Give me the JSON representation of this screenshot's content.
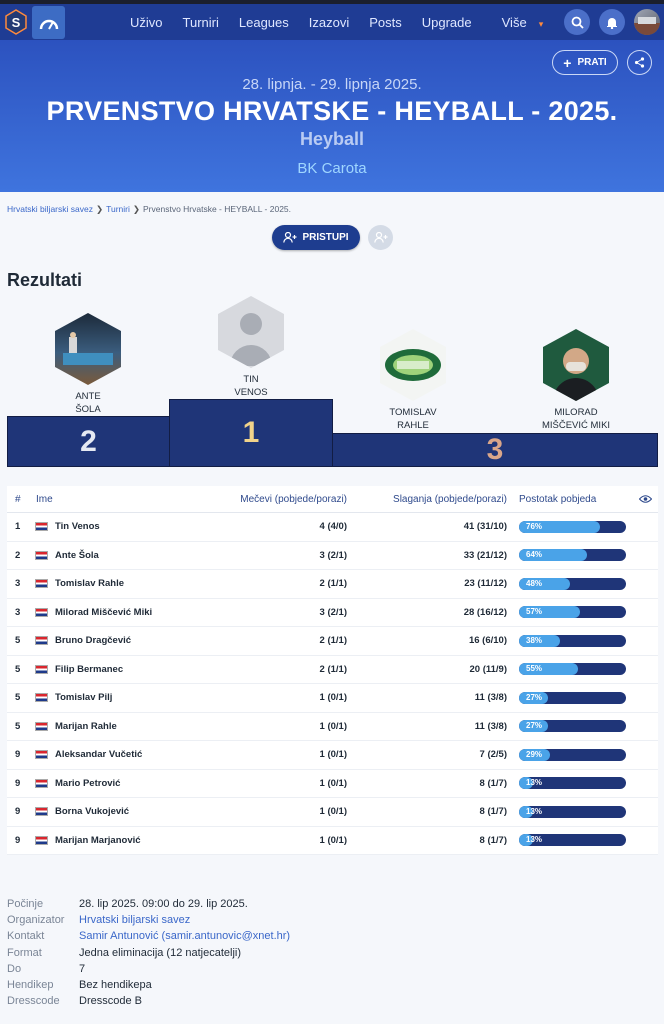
{
  "nav": {
    "links": [
      "Uživo",
      "Turniri",
      "Leagues",
      "Izazovi",
      "Posts",
      "Upgrade",
      "Više"
    ]
  },
  "hero": {
    "dates": "28. lipnja. - 29. lipnja 2025.",
    "title": "PRVENSTVO HRVATSKE - HEYBALL - 2025.",
    "subtitle": "Heyball",
    "venue": "BK Carota",
    "follow_label": "PRATI"
  },
  "breadcrumb": {
    "items": [
      "Hrvatski biljarski savez",
      "Turniri"
    ],
    "current": "Prvenstvo Hrvatske - HEYBALL - 2025."
  },
  "join_label": "PRISTUPI",
  "results_title": "Rezultati",
  "podium": {
    "first": {
      "line1": "TIN",
      "line2": "VENOS",
      "place": "1"
    },
    "second": {
      "line1": "ANTE",
      "line2": "ŠOLA",
      "place": "2"
    },
    "third_a": {
      "line1": "TOMISLAV",
      "line2": "RAHLE"
    },
    "third_b": {
      "line1": "MILORAD",
      "line2": "MIŠČEVIĆ MIKI"
    },
    "third_place": "3"
  },
  "table": {
    "headers": {
      "rank": "#",
      "name": "Ime",
      "matches": "Mečevi (pobjede/porazi)",
      "racks": "Slaganja (pobjede/porazi)",
      "pct": "Postotak pobjeda"
    },
    "rows": [
      {
        "rank": "1",
        "name": "Tin Venos",
        "matches": "4 (4/0)",
        "racks": "41 (31/10)",
        "pct_label": "76%",
        "pct": 76
      },
      {
        "rank": "2",
        "name": "Ante Šola",
        "matches": "3 (2/1)",
        "racks": "33 (21/12)",
        "pct_label": "64%",
        "pct": 64
      },
      {
        "rank": "3",
        "name": "Tomislav Rahle",
        "matches": "2 (1/1)",
        "racks": "23 (11/12)",
        "pct_label": "48%",
        "pct": 48
      },
      {
        "rank": "3",
        "name": "Milorad Miščević Miki",
        "matches": "3 (2/1)",
        "racks": "28 (16/12)",
        "pct_label": "57%",
        "pct": 57
      },
      {
        "rank": "5",
        "name": "Bruno Dragčević",
        "matches": "2 (1/1)",
        "racks": "16 (6/10)",
        "pct_label": "38%",
        "pct": 38
      },
      {
        "rank": "5",
        "name": "Filip Bermanec",
        "matches": "2 (1/1)",
        "racks": "20 (11/9)",
        "pct_label": "55%",
        "pct": 55
      },
      {
        "rank": "5",
        "name": "Tomislav Pilj",
        "matches": "1 (0/1)",
        "racks": "11 (3/8)",
        "pct_label": "27%",
        "pct": 27
      },
      {
        "rank": "5",
        "name": "Marijan Rahle",
        "matches": "1 (0/1)",
        "racks": "11 (3/8)",
        "pct_label": "27%",
        "pct": 27
      },
      {
        "rank": "9",
        "name": "Aleksandar Vučetić",
        "matches": "1 (0/1)",
        "racks": "7 (2/5)",
        "pct_label": "29%",
        "pct": 29
      },
      {
        "rank": "9",
        "name": "Mario Petrović",
        "matches": "1 (0/1)",
        "racks": "8 (1/7)",
        "pct_label": "13%",
        "pct": 13
      },
      {
        "rank": "9",
        "name": "Borna Vukojević",
        "matches": "1 (0/1)",
        "racks": "8 (1/7)",
        "pct_label": "13%",
        "pct": 13
      },
      {
        "rank": "9",
        "name": "Marijan Marjanović",
        "matches": "1 (0/1)",
        "racks": "8 (1/7)",
        "pct_label": "13%",
        "pct": 13
      }
    ]
  },
  "info": {
    "rows": [
      {
        "label": "Počinje",
        "value": "28. lip 2025. 09:00 do 29. lip 2025."
      },
      {
        "label": "Organizator",
        "value": "Hrvatski biljarski savez"
      },
      {
        "label": "Kontakt",
        "value": "Samir Antunović (samir.antunovic@xnet.hr)"
      },
      {
        "label": "Format",
        "value": "Jedna eliminacija (12 natjecatelji)"
      },
      {
        "label": "Do",
        "value": "7"
      },
      {
        "label": "Hendikep",
        "value": "Bez hendikepa"
      },
      {
        "label": "Dresscode",
        "value": "Dresscode B"
      }
    ]
  },
  "colors": {
    "nav_bg": "#1f3c94",
    "hero_bg": "#3f74de",
    "podium_bg": "#1f3578",
    "bar_fill": "#4aa3e8",
    "first_place": "#f1d38a",
    "second_place": "#e5e9f2",
    "third_place": "#d9a68a"
  }
}
